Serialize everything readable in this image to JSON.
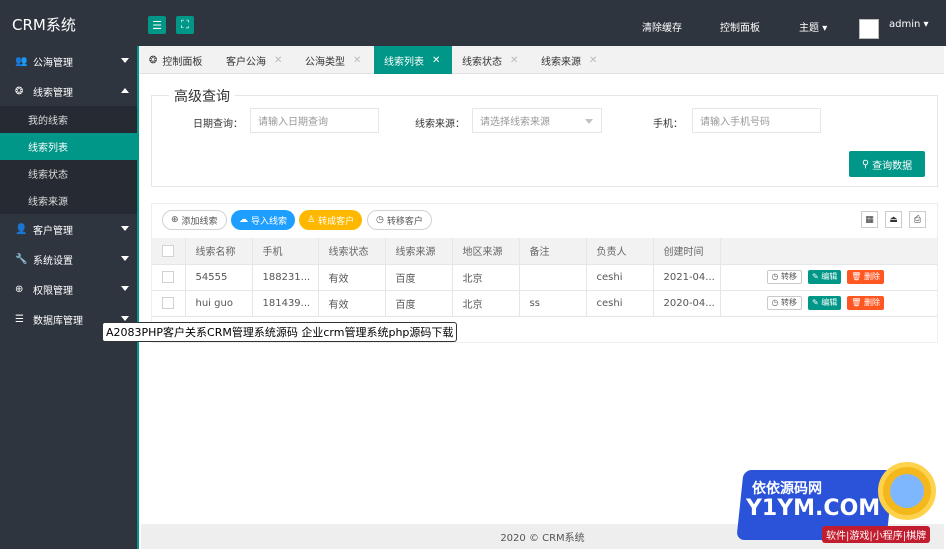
{
  "header": {
    "logo": "CRM系统",
    "links": [
      "清除缓存",
      "控制面板",
      "主题",
      "admin"
    ]
  },
  "sidebar": {
    "items": [
      {
        "label": "公海管理",
        "icon": "user-group-icon",
        "expanded": false
      },
      {
        "label": "线索管理",
        "icon": "compass-icon",
        "expanded": true,
        "children": [
          "我的线索",
          "线索列表",
          "线索状态",
          "线索来源"
        ],
        "active_child": "线索列表"
      },
      {
        "label": "客户管理",
        "icon": "user-icon",
        "expanded": false
      },
      {
        "label": "系统设置",
        "icon": "wrench-icon",
        "expanded": false
      },
      {
        "label": "权限管理",
        "icon": "globe-icon",
        "expanded": false
      },
      {
        "label": "数据库管理",
        "icon": "database-icon",
        "expanded": false
      }
    ]
  },
  "tabs": [
    "控制面板",
    "客户公海",
    "公海类型",
    "线索列表",
    "线索状态",
    "线索来源"
  ],
  "active_tab": "线索列表",
  "search": {
    "legend": "高级查询",
    "date_label": "日期查询：",
    "date_placeholder": "请输入日期查询",
    "source_label": "线索来源：",
    "source_placeholder": "请选择线索来源",
    "phone_label": "手机：",
    "phone_placeholder": "请输入手机号码",
    "query_button": "查询数据"
  },
  "toolbar": {
    "add": "添加线索",
    "import": "导入线索",
    "convert": "转成客户",
    "transfer": "转移客户"
  },
  "table": {
    "columns": [
      "线索名称",
      "手机",
      "线索状态",
      "线索来源",
      "地区来源",
      "备注",
      "负责人",
      "创建时间"
    ],
    "rows": [
      {
        "name": "54555",
        "phone": "188231...",
        "status": "有效",
        "source": "百度",
        "region": "北京",
        "note": "",
        "owner": "ceshi",
        "created": "2021-04..."
      },
      {
        "name": "hui guo",
        "phone": "181439...",
        "status": "有效",
        "source": "百度",
        "region": "北京",
        "note": "ss",
        "owner": "ceshi",
        "created": "2020-04..."
      }
    ],
    "row_actions": {
      "transfer": "转移",
      "edit": "编辑",
      "delete": "删除"
    }
  },
  "footer": "2020 ©   CRM系统",
  "tooltip": "A2083PHP客户关系CRM管理系统源码 企业crm管理系统php源码下载",
  "watermark": {
    "line1": "依依源码网",
    "line2": "Y1YM.COM",
    "line3": "软件|游戏|小程序|棋牌"
  }
}
